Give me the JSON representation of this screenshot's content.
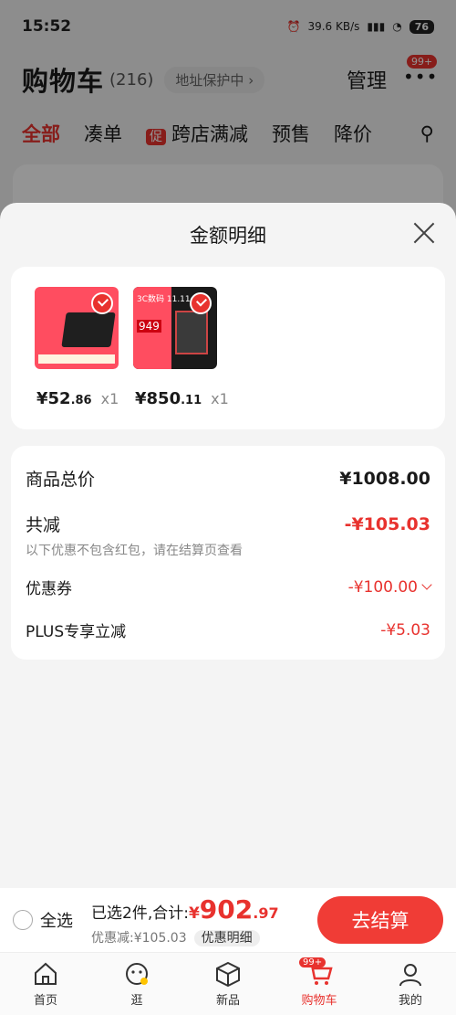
{
  "status": {
    "time": "15:52",
    "speed": "39.6 KB/s",
    "battery": "76"
  },
  "header": {
    "title": "购物车",
    "count": "(216)",
    "address": "地址保护中 ›",
    "manage": "管理",
    "cart_badge": "99+"
  },
  "tabs": [
    {
      "label": "全部"
    },
    {
      "label": "凑单"
    },
    {
      "promo": "促",
      "label": "跨店满减"
    },
    {
      "label": "预售"
    },
    {
      "label": "降价"
    }
  ],
  "sheet": {
    "title": "金额明细",
    "products": [
      {
        "price_int": "¥52",
        "price_dec": ".86",
        "qty": "x1"
      },
      {
        "price_int": "¥850",
        "price_dec": ".11",
        "qty": "x1",
        "tag": "949",
        "label": "3C数码 11.11"
      }
    ],
    "breakdown": {
      "goods_total_label": "商品总价",
      "goods_total_value": "¥1008.00",
      "reduce_label": "共减",
      "reduce_value": "-¥105.03",
      "reduce_note": "以下优惠不包含红包，请在结算页查看",
      "coupon_label": "优惠券",
      "coupon_value": "-¥100.00",
      "plus_label": "PLUS专享立减",
      "plus_value": "-¥5.03"
    }
  },
  "bottom": {
    "select_all": "全选",
    "selected_text": "已选2件,合计:",
    "total_cur": "¥",
    "total_int": "902",
    "total_dec": ".97",
    "discount_text": "优惠减:¥105.03",
    "detail_btn": "优惠明细",
    "checkout": "去结算"
  },
  "nav": [
    {
      "label": "首页",
      "icon": "home-icon"
    },
    {
      "label": "逛",
      "icon": "browse-icon"
    },
    {
      "label": "新品",
      "icon": "box-icon"
    },
    {
      "label": "购物车",
      "icon": "cart-icon",
      "badge": "99+"
    },
    {
      "label": "我的",
      "icon": "user-icon"
    }
  ],
  "colors": {
    "accent": "#e8322e"
  }
}
